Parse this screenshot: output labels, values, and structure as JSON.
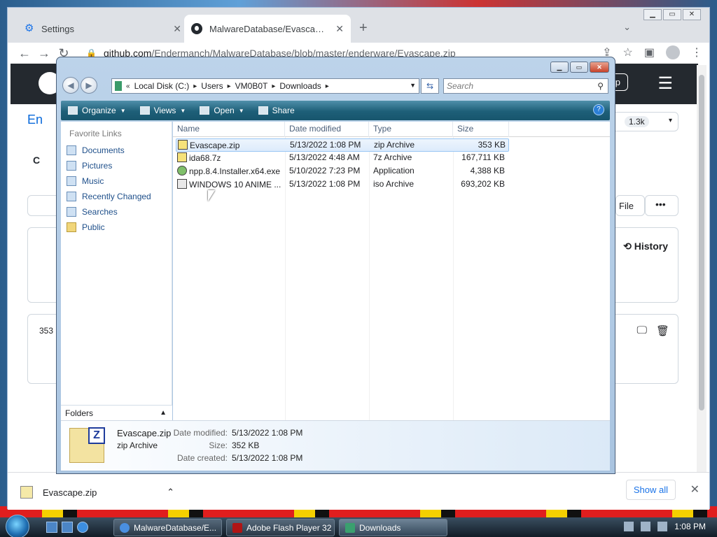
{
  "chrome": {
    "tabs": [
      {
        "label": "Settings",
        "icon": "gear-icon"
      },
      {
        "label": "MalwareDatabase/Evascape.zip a",
        "icon": "github-icon"
      }
    ],
    "url_host": "github.com",
    "url_path": "/Endermanch/MalwareDatabase/blob/master/enderware/Evascape.zip",
    "new_tab": "+"
  },
  "github": {
    "repo_initial": "En",
    "star_count": "1.3k",
    "tab_code": "C",
    "file_btn": "File",
    "history": "History",
    "size": "353",
    "signup": "p"
  },
  "download_bar": {
    "filename": "Evascape.zip",
    "show_all": "Show all"
  },
  "explorer": {
    "breadcrumb": [
      "Local Disk (C:)",
      "Users",
      "VM0B0T",
      "Downloads"
    ],
    "search_placeholder": "Search",
    "commands": [
      "Organize",
      "Views",
      "Open",
      "Share"
    ],
    "favorite_links_heading": "Favorite Links",
    "favorite_links": [
      "Documents",
      "Pictures",
      "Music",
      "Recently Changed",
      "Searches",
      "Public"
    ],
    "folders_label": "Folders",
    "columns": [
      "Name",
      "Date modified",
      "Type",
      "Size"
    ],
    "files": [
      {
        "name": "Evascape.zip",
        "date": "5/13/2022 1:08 PM",
        "type": "zip Archive",
        "size": "353 KB"
      },
      {
        "name": "ida68.7z",
        "date": "5/13/2022 4:48 AM",
        "type": "7z Archive",
        "size": "167,711 KB"
      },
      {
        "name": "npp.8.4.Installer.x64.exe",
        "date": "5/10/2022 7:23 PM",
        "type": "Application",
        "size": "4,388 KB"
      },
      {
        "name": "WINDOWS 10 ANIME ...",
        "date": "5/13/2022 1:08 PM",
        "type": "iso Archive",
        "size": "693,202 KB"
      }
    ],
    "details": {
      "name": "Evascape.zip",
      "type": "zip Archive",
      "date_modified_label": "Date modified:",
      "date_modified": "5/13/2022 1:08 PM",
      "size_label": "Size:",
      "size": "352 KB",
      "date_created_label": "Date created:",
      "date_created": "5/13/2022 1:08 PM"
    }
  },
  "taskbar": {
    "buttons": [
      "MalwareDatabase/E...",
      "Adobe Flash Player 32",
      "Downloads"
    ],
    "clock": "1:08 PM"
  }
}
